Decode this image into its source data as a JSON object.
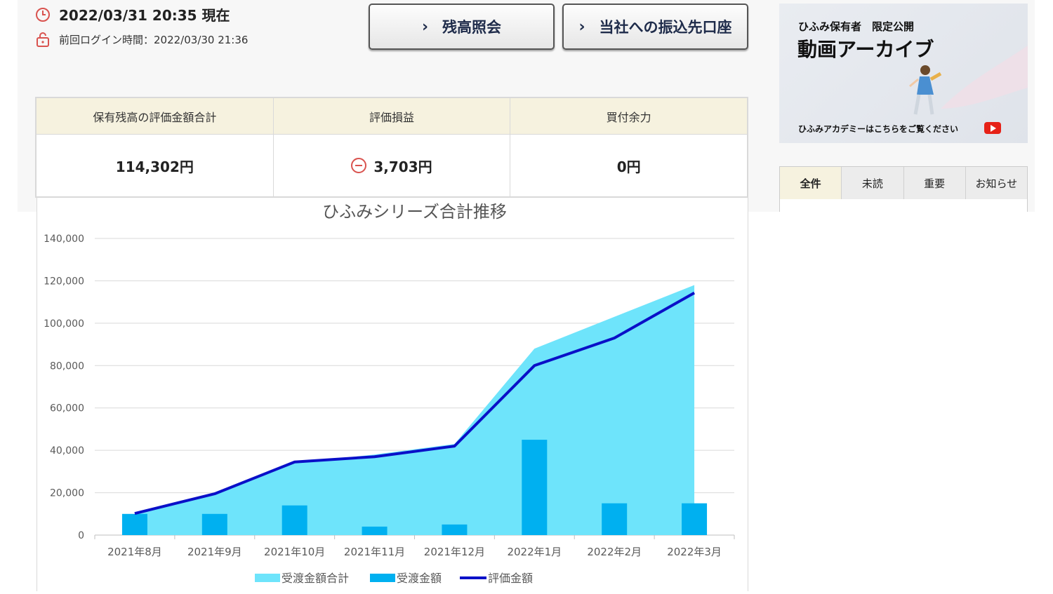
{
  "header": {
    "timestamp": "2022/03/31 20:35 現在",
    "last_login": "前回ログイン時間：2022/03/30 21:36"
  },
  "buttons": {
    "balance": "残高照会",
    "transfer": "当社への振込先口座"
  },
  "summary": {
    "headers": [
      "保有残高の評価金額合計",
      "評価損益",
      "買付余力"
    ],
    "values": [
      "114,302円",
      "3,703円",
      "0円"
    ],
    "pl_sign": "minus"
  },
  "promo": {
    "subtitle": "ひふみ保有者　限定公開",
    "title": "動画アーカイブ",
    "footer": "ひふみアカデミーはこちらをご覧ください"
  },
  "tabs": [
    "全件",
    "未読",
    "重要",
    "お知らせ"
  ],
  "colors": {
    "area": "#6ee4fb",
    "bar": "#00b0f0",
    "line": "#0a10c8",
    "header_bg": "#f6f2df",
    "loss_icon": "#d9534f"
  },
  "chart_data": {
    "type": "bar+area+line",
    "title": "ひふみシリーズ合計推移",
    "categories": [
      "2021年8月",
      "2021年9月",
      "2021年10月",
      "2021年11月",
      "2021年12月",
      "2022年1月",
      "2022年2月",
      "2022年3月"
    ],
    "series": [
      {
        "name": "受渡金額合計",
        "kind": "area",
        "values": [
          10000,
          20000,
          34000,
          38000,
          43000,
          88000,
          103000,
          118000
        ]
      },
      {
        "name": "受渡金額",
        "kind": "bar",
        "values": [
          10000,
          10000,
          14000,
          4000,
          5000,
          45000,
          15000,
          15000
        ]
      },
      {
        "name": "評価金額",
        "kind": "line",
        "values": [
          10200,
          19500,
          34500,
          37000,
          42000,
          80000,
          93000,
          114302
        ]
      }
    ],
    "ylim": [
      0,
      140000
    ],
    "yticks": [
      "0",
      "20,000",
      "40,000",
      "60,000",
      "80,000",
      "100,000",
      "120,000",
      "140,000"
    ],
    "grid": true,
    "legend": "bottom"
  }
}
